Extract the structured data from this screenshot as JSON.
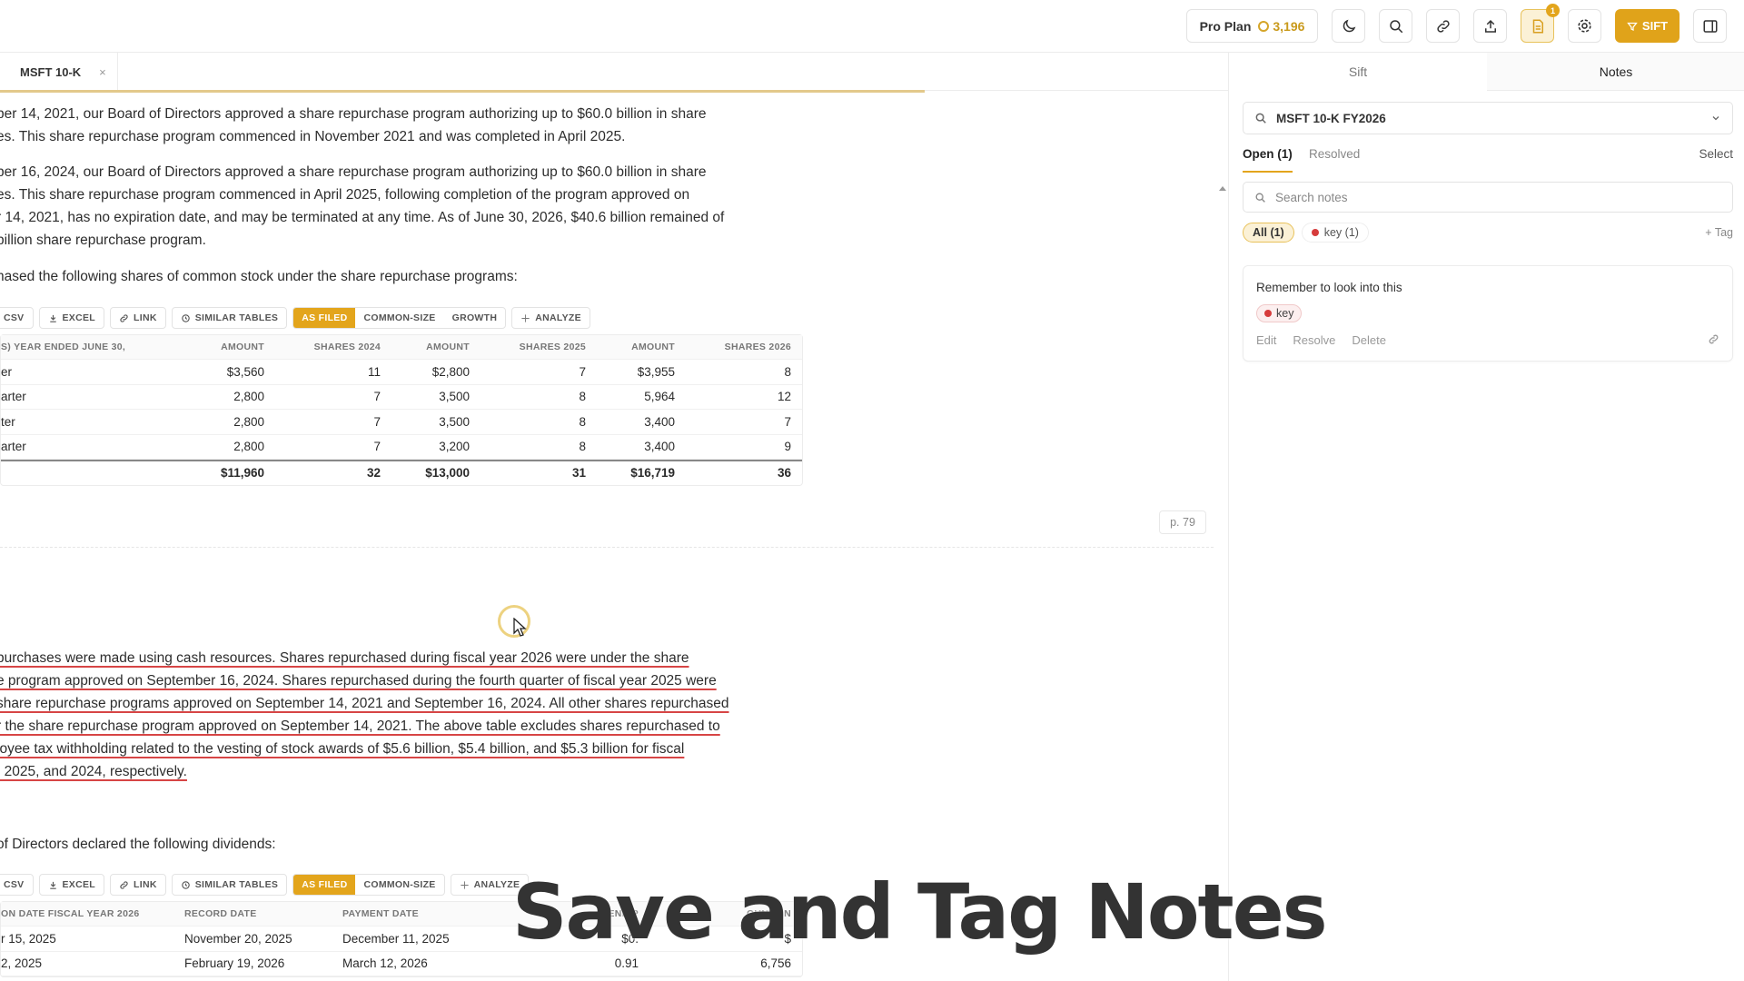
{
  "header": {
    "plan_label": "Pro Plan",
    "credits": "3,196",
    "notes_badge": "1",
    "sift_label": "SIFT"
  },
  "doc_tab": {
    "title": "MSFT 10-K",
    "close": "×"
  },
  "document": {
    "para1": [
      "ber 14, 2021, our Board of Directors approved a share repurchase program authorizing up to $60.0 billion in share",
      "es. This share repurchase program commenced in November 2021 and was completed in April 2025."
    ],
    "para2": [
      "ber 16, 2024, our Board of Directors approved a share repurchase program authorizing up to $60.0 billion in share",
      "es. This share repurchase program commenced in April 2025, following completion of the program approved on",
      "r 14, 2021, has no expiration date, and may be terminated at any time. As of June 30, 2026, $40.6 billion remained of",
      "billion share repurchase program."
    ],
    "para3": "hased the following shares of common stock under the share repurchase programs:",
    "toolbar1": {
      "csv": "CSV",
      "excel": "EXCEL",
      "link": "LINK",
      "similar": "SIMILAR TABLES",
      "as_filed": "AS FILED",
      "common_size": "COMMON-SIZE",
      "growth": "GROWTH",
      "analyze": "ANALYZE"
    },
    "table1": {
      "headers": [
        "S) YEAR ENDED JUNE 30,",
        "AMOUNT",
        "SHARES 2024",
        "AMOUNT",
        "SHARES 2025",
        "AMOUNT",
        "SHARES 2026"
      ],
      "rows": [
        [
          "er",
          "$3,560",
          "11",
          "$2,800",
          "7",
          "$3,955",
          "8"
        ],
        [
          "arter",
          "2,800",
          "7",
          "3,500",
          "8",
          "5,964",
          "12"
        ],
        [
          "ter",
          "2,800",
          "7",
          "3,500",
          "8",
          "3,400",
          "7"
        ],
        [
          "arter",
          "2,800",
          "7",
          "3,200",
          "8",
          "3,400",
          "9"
        ]
      ],
      "total": [
        "",
        "$11,960",
        "32",
        "$13,000",
        "31",
        "$16,719",
        "36"
      ]
    },
    "page_label": "p. 79",
    "para4": [
      "purchases were made using cash resources. Shares repurchased during fiscal year 2026 were under the share",
      "e program approved on September 16, 2024. Shares repurchased during the fourth quarter of fiscal year 2025 were",
      "share repurchase programs approved on September 14, 2021 and September 16, 2024. All other shares repurchased",
      "r the share repurchase program approved on September 14, 2021. The above table excludes shares repurchased to",
      "loyee tax withholding related to the vesting of stock awards of $5.6 billion, $5.4 billion, and $5.3 billion for fiscal",
      ", 2025, and 2024, respectively."
    ],
    "para5": "of Directors declared the following dividends:",
    "toolbar2": {
      "csv": "CSV",
      "excel": "EXCEL",
      "link": "LINK",
      "similar": "SIMILAR TABLES",
      "as_filed": "AS FILED",
      "common_size": "COMMON-SIZE",
      "analyze": "ANALYZE"
    },
    "table2": {
      "headers": [
        "ON DATE FISCAL YEAR 2026",
        "RECORD DATE",
        "PAYMENT DATE",
        "DEND P",
        "OUNT (IN"
      ],
      "rows": [
        [
          "r 15, 2025",
          "November 20, 2025",
          "December 11, 2025",
          "$0.",
          "$"
        ],
        [
          "2, 2025",
          "February 19, 2026",
          "March 12, 2026",
          "0.91",
          "6,756"
        ]
      ]
    }
  },
  "panel": {
    "tabs": {
      "sift": "Sift",
      "notes": "Notes"
    },
    "scope": "MSFT 10-K FY2026",
    "subtabs": {
      "open": "Open (1)",
      "resolved": "Resolved",
      "select": "Select"
    },
    "search_placeholder": "Search notes",
    "filters": {
      "all": "All (1)",
      "key": "key (1)",
      "add_tag": "+ Tag"
    },
    "note": {
      "text": "Remember to look into this",
      "tag": "key",
      "actions": {
        "edit": "Edit",
        "resolve": "Resolve",
        "delete": "Delete"
      }
    }
  },
  "caption": "Save and Tag Notes",
  "colors": {
    "accent": "#e3a51c",
    "tag_red": "#d63c3c",
    "underline": "#d74545"
  }
}
